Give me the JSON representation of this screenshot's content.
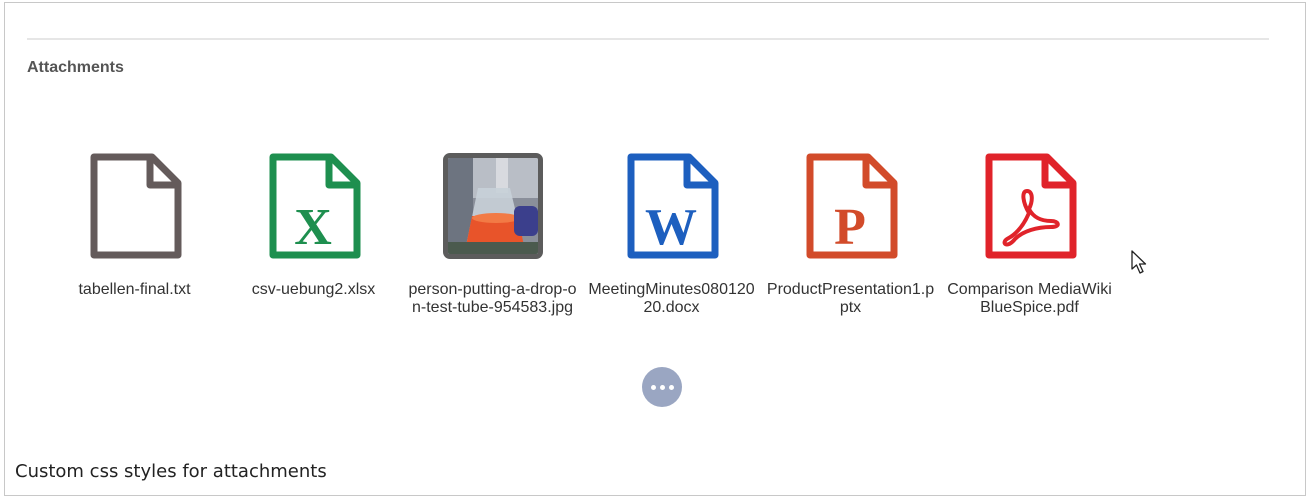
{
  "section": {
    "title": "Attachments"
  },
  "attachments": [
    {
      "name": "tabellen-final.txt",
      "icon": "txt-file-icon",
      "color": "#645b5b"
    },
    {
      "name": "csv-uebung2.xlsx",
      "icon": "excel-file-icon",
      "color": "#1e8f4f",
      "letter": "X"
    },
    {
      "name": "person-putting-a-drop-on-test-tube-954583.jpg",
      "icon": "image-thumbnail",
      "color": "#5c5c5c"
    },
    {
      "name": "MeetingMinutes08012020.docx",
      "icon": "word-file-icon",
      "color": "#1d5fbf",
      "letter": "W"
    },
    {
      "name": "ProductPresentation1.pptx",
      "icon": "powerpoint-file-icon",
      "color": "#d24b2a",
      "letter": "P"
    },
    {
      "name": "Comparison MediaWiki BlueSpice.pdf",
      "icon": "pdf-file-icon",
      "color": "#e0232a"
    }
  ],
  "more": {
    "icon": "more-dots-icon",
    "color": "#9aa6c2"
  },
  "caption": "Custom css styles for attachments"
}
